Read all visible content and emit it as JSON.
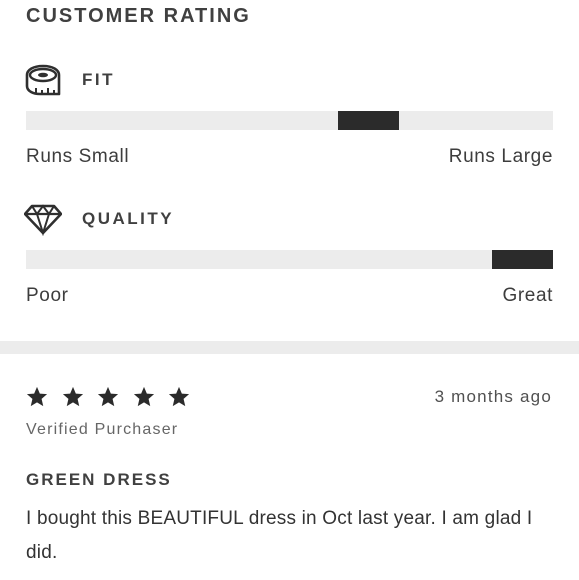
{
  "rating": {
    "title": "CUSTOMER RATING",
    "fit": {
      "label": "FIT",
      "icon": "measuring-tape-icon",
      "value_fraction": 0.65,
      "low_label": "Runs Small",
      "high_label": "Runs Large"
    },
    "quality": {
      "label": "QUALITY",
      "icon": "diamond-icon",
      "value_fraction": 0.95,
      "low_label": "Poor",
      "high_label": "Great"
    }
  },
  "review": {
    "stars": 5,
    "date": "3 months ago",
    "verified": "Verified Purchaser",
    "title": "GREEN DRESS",
    "body": "I bought this BEAUTIFUL dress in Oct last year. I am glad I did."
  },
  "colors": {
    "track": "#ececec",
    "marker": "#2b2b2b",
    "star": "#2b2b2b",
    "divider": "#ececec"
  }
}
